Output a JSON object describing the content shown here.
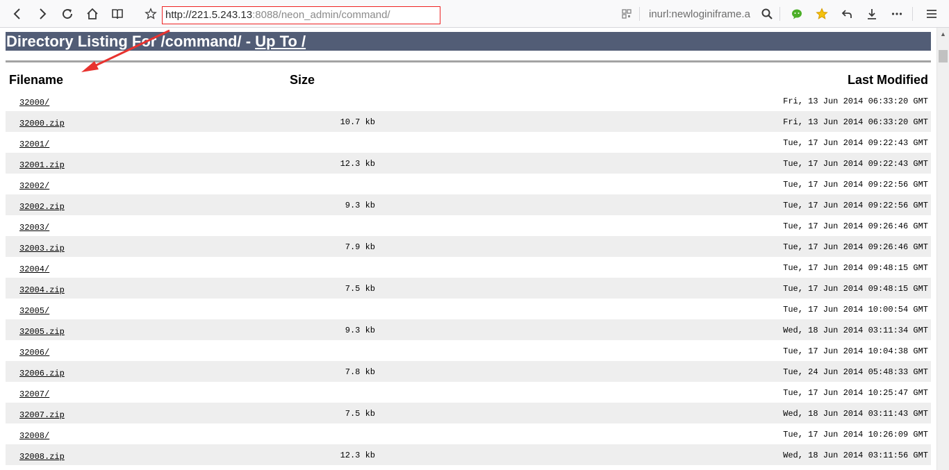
{
  "browser": {
    "url_host": "http://221.5.243.13",
    "url_rest": ":8088/neon_admin/command/",
    "search_text": "inurl:newloginiframe.a",
    "icons": {
      "back": "back-arrow-icon",
      "forward": "forward-arrow-icon",
      "reload": "reload-icon",
      "home": "home-icon",
      "library": "library-icon",
      "bookmark": "star-outline-icon",
      "qr": "qr-code-icon",
      "search": "search-icon",
      "wechat": "wechat-icon",
      "favorites": "star-filled-icon",
      "undo": "undo-arrow-icon",
      "download": "download-icon",
      "more": "more-dots-icon",
      "menu": "hamburger-menu-icon"
    }
  },
  "listing": {
    "heading_prefix": "Directory Listing For /command/ - ",
    "heading_link": "Up To /",
    "columns": {
      "filename": "Filename",
      "size": "Size",
      "modified": "Last Modified"
    },
    "rows": [
      {
        "name": "32000/",
        "size": "",
        "modified": "Fri, 13 Jun 2014 06:33:20 GMT"
      },
      {
        "name": "32000.zip",
        "size": "10.7 kb",
        "modified": "Fri, 13 Jun 2014 06:33:20 GMT"
      },
      {
        "name": "32001/",
        "size": "",
        "modified": "Tue, 17 Jun 2014 09:22:43 GMT"
      },
      {
        "name": "32001.zip",
        "size": "12.3 kb",
        "modified": "Tue, 17 Jun 2014 09:22:43 GMT"
      },
      {
        "name": "32002/",
        "size": "",
        "modified": "Tue, 17 Jun 2014 09:22:56 GMT"
      },
      {
        "name": "32002.zip",
        "size": "9.3 kb",
        "modified": "Tue, 17 Jun 2014 09:22:56 GMT"
      },
      {
        "name": "32003/",
        "size": "",
        "modified": "Tue, 17 Jun 2014 09:26:46 GMT"
      },
      {
        "name": "32003.zip",
        "size": "7.9 kb",
        "modified": "Tue, 17 Jun 2014 09:26:46 GMT"
      },
      {
        "name": "32004/",
        "size": "",
        "modified": "Tue, 17 Jun 2014 09:48:15 GMT"
      },
      {
        "name": "32004.zip",
        "size": "7.5 kb",
        "modified": "Tue, 17 Jun 2014 09:48:15 GMT"
      },
      {
        "name": "32005/",
        "size": "",
        "modified": "Tue, 17 Jun 2014 10:00:54 GMT"
      },
      {
        "name": "32005.zip",
        "size": "9.3 kb",
        "modified": "Wed, 18 Jun 2014 03:11:34 GMT"
      },
      {
        "name": "32006/",
        "size": "",
        "modified": "Tue, 17 Jun 2014 10:04:38 GMT"
      },
      {
        "name": "32006.zip",
        "size": "7.8 kb",
        "modified": "Tue, 24 Jun 2014 05:48:33 GMT"
      },
      {
        "name": "32007/",
        "size": "",
        "modified": "Tue, 17 Jun 2014 10:25:47 GMT"
      },
      {
        "name": "32007.zip",
        "size": "7.5 kb",
        "modified": "Wed, 18 Jun 2014 03:11:43 GMT"
      },
      {
        "name": "32008/",
        "size": "",
        "modified": "Tue, 17 Jun 2014 10:26:09 GMT"
      },
      {
        "name": "32008.zip",
        "size": "12.3 kb",
        "modified": "Wed, 18 Jun 2014 03:11:56 GMT"
      }
    ]
  },
  "colors": {
    "heading_bg": "#525d76",
    "row_shade": "#eeeeee",
    "annotation": "#e8332f",
    "url_border": "#e22222"
  }
}
